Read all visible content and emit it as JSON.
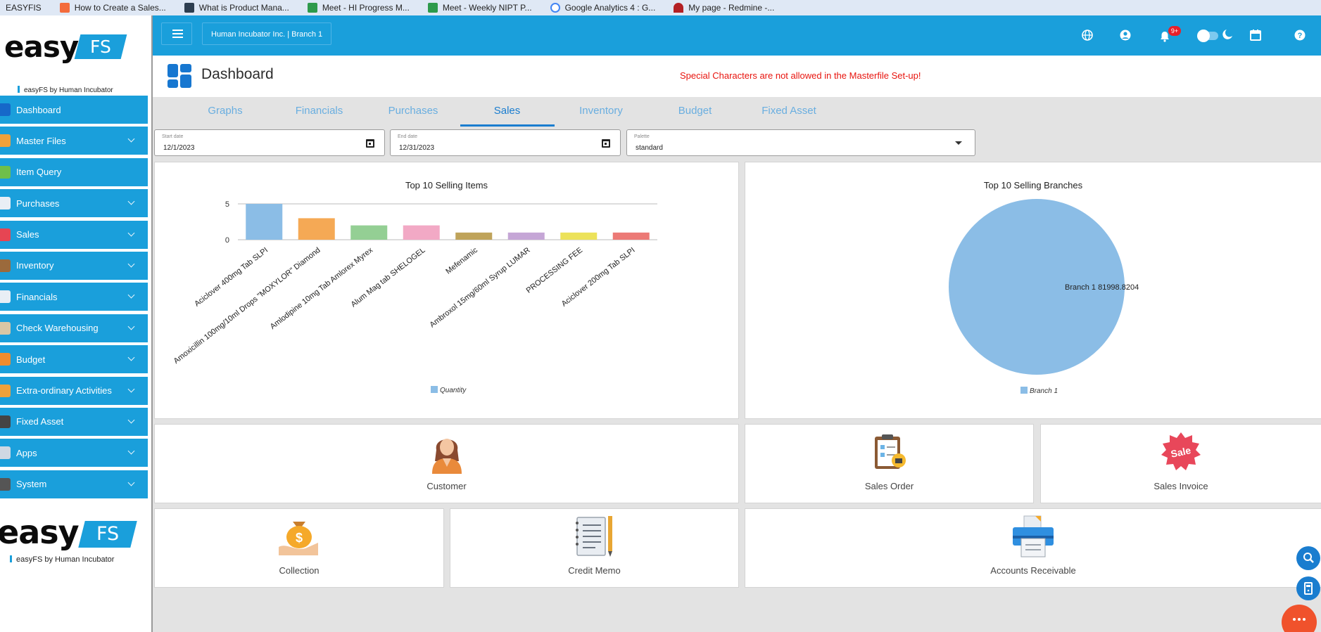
{
  "bookmarks": [
    {
      "label": "EASYFIS",
      "icon": "none"
    },
    {
      "label": "How to Create a Sales...",
      "icon": "orange-doc-icon"
    },
    {
      "label": "What is Product Mana...",
      "icon": "pr-icon"
    },
    {
      "label": "Meet - HI Progress M...",
      "icon": "meet-icon"
    },
    {
      "label": "Meet - Weekly NIPT P...",
      "icon": "meet-icon"
    },
    {
      "label": "Google Analytics 4 : G...",
      "icon": "google-icon"
    },
    {
      "label": "My page - Redmine -...",
      "icon": "redmine-icon"
    }
  ],
  "logo": {
    "word": "easy",
    "badge": "FS",
    "tagline": "easyFS by Human Incubator"
  },
  "nav": [
    {
      "label": "Dashboard",
      "icon": "dashboard-icon",
      "color": "#1668c9",
      "chevron": false
    },
    {
      "label": "Master Files",
      "icon": "master-files-icon",
      "color": "#f0a13a",
      "chevron": true
    },
    {
      "label": "Item Query",
      "icon": "item-query-icon",
      "color": "#6fbf4a",
      "chevron": false
    },
    {
      "label": "Purchases",
      "icon": "purchases-icon",
      "color": "#e8eef5",
      "chevron": true
    },
    {
      "label": "Sales",
      "icon": "sales-icon",
      "color": "#e64553",
      "chevron": true
    },
    {
      "label": "Inventory",
      "icon": "inventory-icon",
      "color": "#9b6a3c",
      "chevron": true
    },
    {
      "label": "Financials",
      "icon": "financials-icon",
      "color": "#e8eef5",
      "chevron": true
    },
    {
      "label": "Check Warehousing",
      "icon": "check-warehousing-icon",
      "color": "#d9c7a5",
      "chevron": true
    },
    {
      "label": "Budget",
      "icon": "budget-icon",
      "color": "#f08c2c",
      "chevron": true
    },
    {
      "label": "Extra-ordinary Activities",
      "icon": "extraordinary-icon",
      "color": "#f0a13a",
      "chevron": true
    },
    {
      "label": "Fixed Asset",
      "icon": "fixed-asset-icon",
      "color": "#444444",
      "chevron": true
    },
    {
      "label": "Apps",
      "icon": "apps-icon",
      "color": "#cfd8e3",
      "chevron": true
    },
    {
      "label": "System",
      "icon": "system-icon",
      "color": "#555555",
      "chevron": true
    }
  ],
  "topbar": {
    "company": "Human Incubator Inc. | Branch 1",
    "notification_badge": "9+"
  },
  "header": {
    "title": "Dashboard",
    "warning": "Special Characters are not allowed in the Masterfile Set-up!"
  },
  "tabs": [
    {
      "label": "Graphs",
      "active": false
    },
    {
      "label": "Financials",
      "active": false
    },
    {
      "label": "Purchases",
      "active": false
    },
    {
      "label": "Sales",
      "active": true
    },
    {
      "label": "Inventory",
      "active": false
    },
    {
      "label": "Budget",
      "active": false
    },
    {
      "label": "Fixed Asset",
      "active": false
    }
  ],
  "filters": {
    "start_label": "Start date",
    "start_value": "12/1/2023",
    "end_label": "End date",
    "end_value": "12/31/2023",
    "palette_label": "Palette",
    "palette_value": "standard"
  },
  "chart_data": [
    {
      "type": "bar",
      "title": "Top 10 Selling Items",
      "categories": [
        "Aciclover 400mg Tab SLPI",
        "Amoxicillin 100mg/10ml Drops \"MOXYLOR\" Diamond",
        "Amlodipine 10mg Tab Amlorex Myrex",
        "Alum Mag tab SHELOGEL",
        "Mefenamic",
        "Ambroxol 15mg/60ml Syrup LUMAR",
        "PROCESSING FEE",
        "Aciclover 200mg Tab SLPI"
      ],
      "series": [
        {
          "name": "Quantity",
          "values": [
            5,
            3,
            2,
            2,
            1,
            1,
            1,
            1
          ]
        }
      ],
      "colors": [
        "#8bbde6",
        "#f5a955",
        "#94cf94",
        "#f2a9c5",
        "#bfa35a",
        "#c5a6d6",
        "#ece25a",
        "#ec7a76"
      ],
      "yticks": [
        "5",
        "0"
      ],
      "ylim": [
        0,
        5
      ],
      "legend": "bottom"
    },
    {
      "type": "pie",
      "title": "Top 10 Selling Branches",
      "slices": [
        {
          "label": "Branch 1",
          "value": 81998.8204,
          "display": "Branch 1 81998.8204",
          "color": "#8bbde6"
        }
      ],
      "legend": "bottom"
    }
  ],
  "tiles": [
    {
      "label": "Customer",
      "icon": "customer-icon"
    },
    {
      "label": "Sales Order",
      "icon": "sales-order-icon"
    },
    {
      "label": "Sales Invoice",
      "icon": "sales-invoice-icon",
      "badge_text": "Sale"
    },
    {
      "label": "Collection",
      "icon": "collection-icon"
    },
    {
      "label": "Credit Memo",
      "icon": "credit-memo-icon"
    },
    {
      "label": "Accounts Receivable",
      "icon": "accounts-receivable-icon"
    }
  ]
}
